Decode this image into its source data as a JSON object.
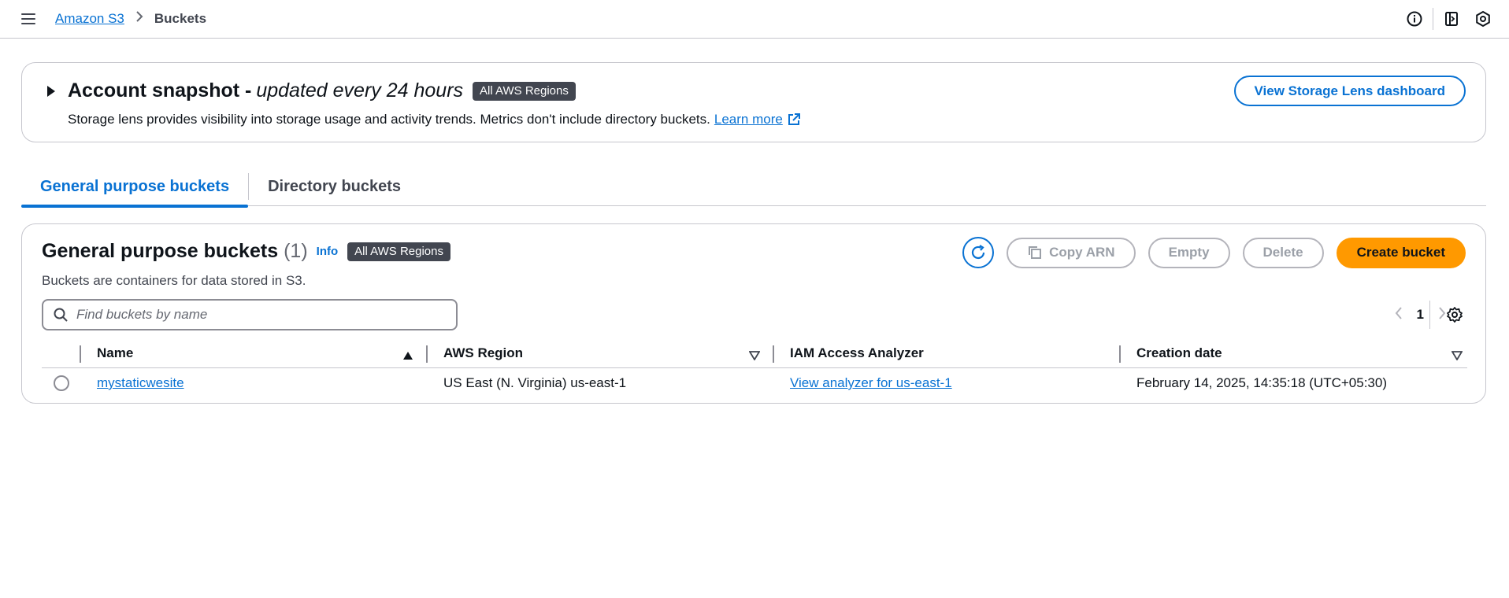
{
  "breadcrumb": {
    "root": "Amazon S3",
    "current": "Buckets"
  },
  "topbar_icons": [
    "info-icon",
    "feedback-icon",
    "settings-hexagon-icon"
  ],
  "snapshot": {
    "title": "Account snapshot -",
    "title_italic": "updated every 24 hours",
    "badge": "All AWS Regions",
    "description": "Storage lens provides visibility into storage usage and activity trends. Metrics don't include directory buckets.",
    "learn_more": "Learn more",
    "dashboard_button": "View Storage Lens dashboard"
  },
  "tabs": [
    {
      "label": "General purpose buckets",
      "active": true
    },
    {
      "label": "Directory buckets",
      "active": false
    }
  ],
  "buckets": {
    "title": "General purpose buckets",
    "count": "(1)",
    "info": "Info",
    "badge": "All AWS Regions",
    "description": "Buckets are containers for data stored in S3.",
    "actions": {
      "copy_arn": "Copy ARN",
      "empty": "Empty",
      "delete": "Delete",
      "create": "Create bucket"
    },
    "search_placeholder": "Find buckets by name",
    "page": "1",
    "columns": [
      "Name",
      "AWS Region",
      "IAM Access Analyzer",
      "Creation date"
    ],
    "rows": [
      {
        "name": "mystaticwesite",
        "region": "US East (N. Virginia) us-east-1",
        "iam": "View analyzer for us-east-1",
        "created": "February 14, 2025, 14:35:18 (UTC+05:30)"
      }
    ]
  },
  "colors": {
    "accent": "#0972d3",
    "primary_button": "#ff9900",
    "badge_bg": "#424650",
    "border": "#c6c6cd"
  }
}
